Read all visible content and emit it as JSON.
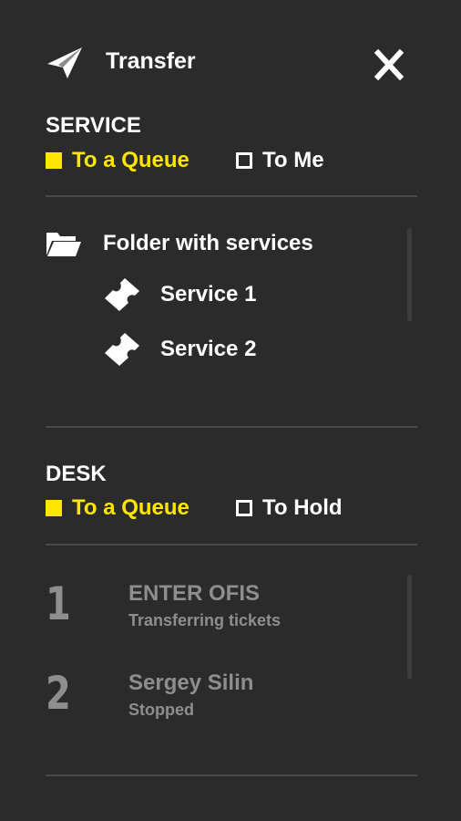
{
  "header": {
    "title": "Transfer",
    "send_icon": "paper-plane-icon",
    "close_icon": "close-icon"
  },
  "colors": {
    "background": "#2b2b2b",
    "accent": "#ffe500",
    "muted": "#8e8e8e",
    "divider": "#4a4a4a"
  },
  "service": {
    "heading": "SERVICE",
    "options": [
      {
        "label": "To a Queue",
        "selected": true
      },
      {
        "label": "To Me",
        "selected": false
      }
    ],
    "folder": {
      "label": "Folder with services",
      "icon": "folder-open-icon",
      "services": [
        {
          "label": "Service 1",
          "icon": "ticket-icon"
        },
        {
          "label": "Service 2",
          "icon": "ticket-icon"
        }
      ]
    }
  },
  "desk": {
    "heading": "DESK",
    "options": [
      {
        "label": "To a Queue",
        "selected": true
      },
      {
        "label": "To Hold",
        "selected": false
      }
    ],
    "items": [
      {
        "number": "1",
        "name": "ENTER OFIS",
        "status": "Transferring tickets"
      },
      {
        "number": "2",
        "name": "Sergey Silin",
        "status": "Stopped"
      }
    ]
  }
}
